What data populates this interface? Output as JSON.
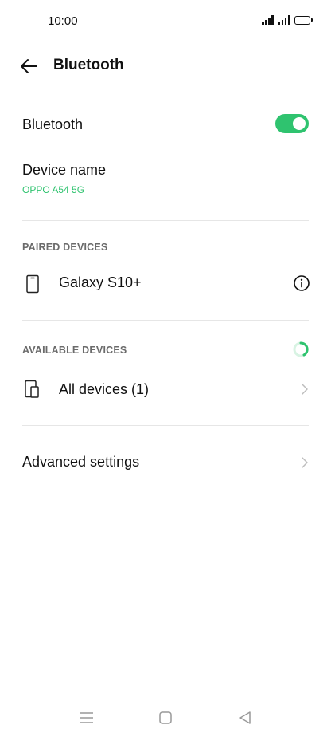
{
  "status_bar": {
    "time": "10:00",
    "icons": [
      "signal-icon",
      "signal-icon",
      "battery-icon"
    ]
  },
  "app_bar": {
    "back_icon": "arrow-left-icon",
    "title": "Bluetooth"
  },
  "bluetooth_toggle": {
    "label": "Bluetooth",
    "enabled": true,
    "accent_color": "#2fc36f"
  },
  "device_name": {
    "label": "Device name",
    "value": "OPPO A54 5G"
  },
  "paired_devices": {
    "header": "PAIRED DEVICES",
    "items": [
      {
        "name": "Galaxy S10+",
        "icon": "phone-icon",
        "action_icon": "info-icon"
      }
    ]
  },
  "available_devices": {
    "header": "AVAILABLE DEVICES",
    "status_icon": "loading-spinner-icon",
    "items": [
      {
        "name": "All devices (1)",
        "icon": "devices-icon",
        "action_icon": "chevron-right-icon"
      }
    ]
  },
  "advanced_settings": {
    "label": "Advanced settings",
    "action_icon": "chevron-right-icon"
  },
  "nav_bar": {
    "icons": [
      "menu-icon",
      "home-icon",
      "back-triangle-icon"
    ]
  }
}
